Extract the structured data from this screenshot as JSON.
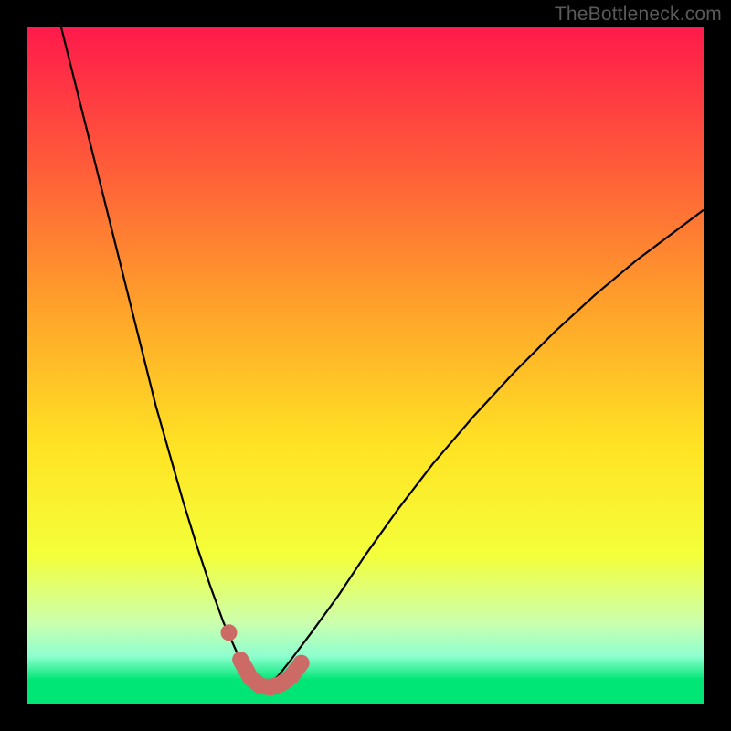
{
  "watermark": "TheBottleneck.com",
  "chart_data": {
    "type": "line",
    "title": "",
    "xlabel": "",
    "ylabel": "",
    "xlim": [
      0,
      100
    ],
    "ylim": [
      0,
      100
    ],
    "background_gradient": {
      "stops": [
        {
          "pos": 0.0,
          "color": "#ff1a4b"
        },
        {
          "pos": 0.2,
          "color": "#ff5a3a"
        },
        {
          "pos": 0.42,
          "color": "#ffa42a"
        },
        {
          "pos": 0.62,
          "color": "#ffe324"
        },
        {
          "pos": 0.78,
          "color": "#f4ff3a"
        },
        {
          "pos": 0.88,
          "color": "#ccffad"
        },
        {
          "pos": 0.93,
          "color": "#8effd0"
        },
        {
          "pos": 0.965,
          "color": "#00e676"
        },
        {
          "pos": 1.0,
          "color": "#00e676"
        }
      ]
    },
    "series": [
      {
        "name": "bottleneck-curve-left",
        "stroke": "#000000",
        "stroke_width": 2.2,
        "x": [
          5,
          7,
          9,
          11,
          13,
          15,
          17,
          19,
          21,
          23,
          25,
          27,
          29,
          31,
          32.5,
          34,
          35
        ],
        "y": [
          100,
          92,
          84,
          76,
          68,
          60,
          52,
          44,
          37,
          30,
          23.5,
          17.5,
          12,
          7.5,
          5.0,
          3.2,
          2.5
        ]
      },
      {
        "name": "bottleneck-curve-right",
        "stroke": "#000000",
        "stroke_width": 2.2,
        "x": [
          35,
          37,
          39,
          42,
          46,
          50,
          55,
          60,
          66,
          72,
          78,
          84,
          90,
          96,
          100
        ],
        "y": [
          2.5,
          4.0,
          6.5,
          10.5,
          16,
          22,
          29,
          35.5,
          42.5,
          49,
          55,
          60.5,
          65.5,
          70,
          73
        ]
      },
      {
        "name": "highlight-band",
        "stroke": "#cc6b66",
        "stroke_width": 18,
        "linecap": "round",
        "x": [
          31.5,
          33,
          34.5,
          36,
          37.5,
          39,
          40.5
        ],
        "y": [
          6.5,
          3.8,
          2.6,
          2.4,
          2.9,
          4.0,
          6.0
        ]
      },
      {
        "name": "highlight-dot",
        "type": "scatter",
        "fill": "#cc6b66",
        "radius": 9,
        "x": [
          29.8
        ],
        "y": [
          10.5
        ]
      }
    ]
  }
}
